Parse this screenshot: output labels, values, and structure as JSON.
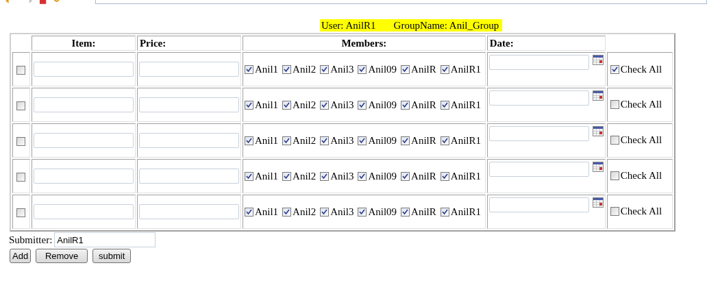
{
  "banner": {
    "user": "User: AnilR1",
    "group": "GroupName: Anil_Group"
  },
  "table": {
    "columns": [
      "Item:",
      "Price:",
      "Members:",
      "Date:"
    ],
    "rows": [
      {
        "selected": false,
        "item": "",
        "price": "",
        "date": "",
        "check_all": {
          "label": "Check All",
          "checked": true
        },
        "members": [
          {
            "label": "Anil1",
            "checked": true
          },
          {
            "label": "Anil2",
            "checked": true
          },
          {
            "label": "Anil3",
            "checked": true
          },
          {
            "label": "Anil09",
            "checked": true
          },
          {
            "label": "AnilR",
            "checked": true
          },
          {
            "label": "AnilR1",
            "checked": true
          }
        ]
      },
      {
        "selected": false,
        "item": "",
        "price": "",
        "date": "",
        "check_all": {
          "label": "Check All",
          "checked": false
        },
        "members": [
          {
            "label": "Anil1",
            "checked": true
          },
          {
            "label": "Anil2",
            "checked": true
          },
          {
            "label": "Anil3",
            "checked": true
          },
          {
            "label": "Anil09",
            "checked": true
          },
          {
            "label": "AnilR",
            "checked": true
          },
          {
            "label": "AnilR1",
            "checked": true
          }
        ]
      },
      {
        "selected": false,
        "item": "",
        "price": "",
        "date": "",
        "check_all": {
          "label": "Check All",
          "checked": false
        },
        "members": [
          {
            "label": "Anil1",
            "checked": true
          },
          {
            "label": "Anil2",
            "checked": true
          },
          {
            "label": "Anil3",
            "checked": true
          },
          {
            "label": "Anil09",
            "checked": true
          },
          {
            "label": "AnilR",
            "checked": true
          },
          {
            "label": "AnilR1",
            "checked": true
          }
        ]
      },
      {
        "selected": false,
        "item": "",
        "price": "",
        "date": "",
        "check_all": {
          "label": "Check All",
          "checked": false
        },
        "members": [
          {
            "label": "Anil1",
            "checked": true
          },
          {
            "label": "Anil2",
            "checked": true
          },
          {
            "label": "Anil3",
            "checked": true
          },
          {
            "label": "Anil09",
            "checked": true
          },
          {
            "label": "AnilR",
            "checked": true
          },
          {
            "label": "AnilR1",
            "checked": true
          }
        ]
      },
      {
        "selected": false,
        "item": "",
        "price": "",
        "date": "",
        "check_all": {
          "label": "Check All",
          "checked": false
        },
        "members": [
          {
            "label": "Anil1",
            "checked": true
          },
          {
            "label": "Anil2",
            "checked": true
          },
          {
            "label": "Anil3",
            "checked": true
          },
          {
            "label": "Anil09",
            "checked": true
          },
          {
            "label": "AnilR",
            "checked": true
          },
          {
            "label": "AnilR1",
            "checked": true
          }
        ]
      }
    ]
  },
  "submitter": {
    "label": "Submitter:",
    "value": "AnilR1"
  },
  "buttons": [
    "Add",
    "Remove",
    "submit"
  ]
}
